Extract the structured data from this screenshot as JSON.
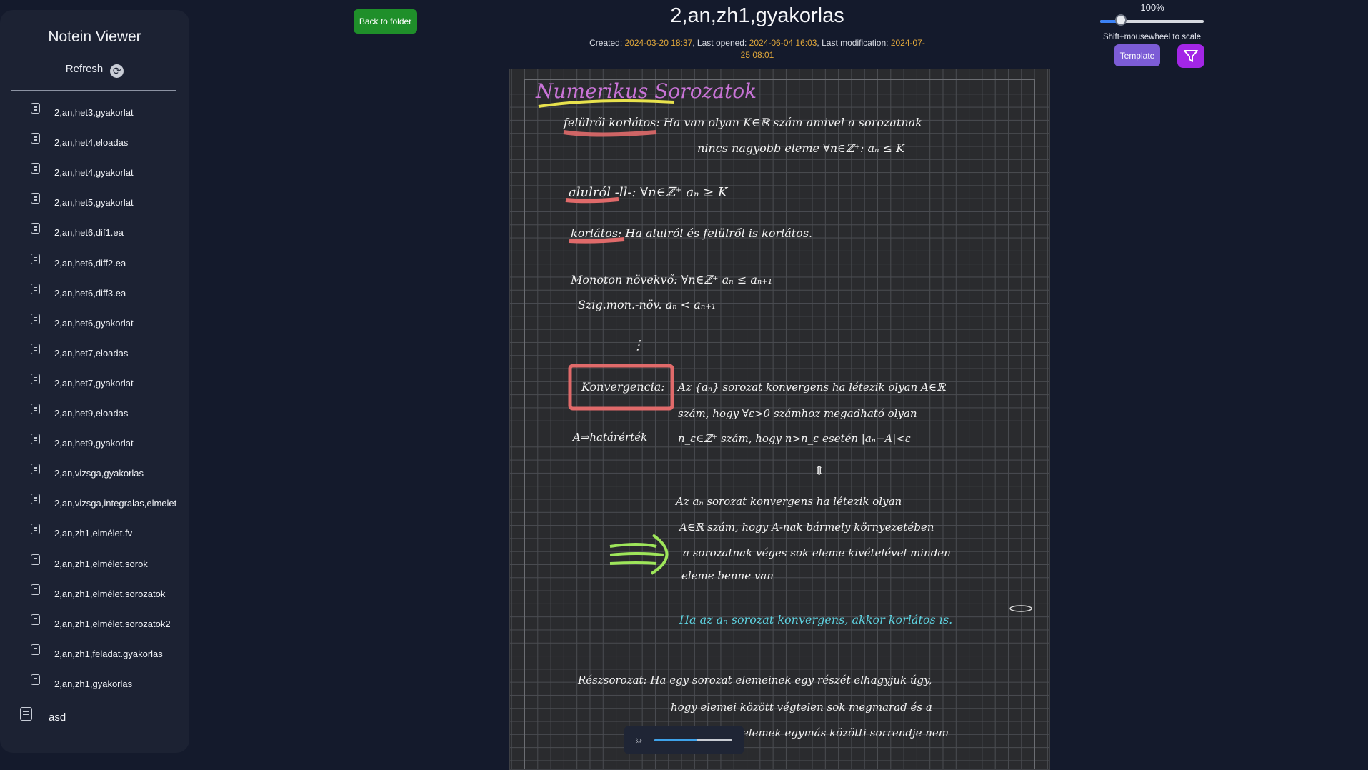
{
  "sidebar": {
    "app_title": "Notein Viewer",
    "refresh_label": "Refresh",
    "files": [
      "2,an,het3,gyakorlat",
      "2,an,het4,eloadas",
      "2,an,het4,gyakorlat",
      "2,an,het5,gyakorlat",
      "2,an,het6,dif1.ea",
      "2,an,het6,diff2.ea",
      "2,an,het6,diff3.ea",
      "2,an,het6,gyakorlat",
      "2,an,het7,eloadas",
      "2,an,het7,gyakorlat",
      "2,an,het9,eloadas",
      "2,an,het9,gyakorlat",
      "2,an,vizsga,gyakorlas",
      "2,an,vizsga,integralas,elmelet",
      "2,an,zh1,elmélet.fv",
      "2,an,zh1,elmélet.sorok",
      "2,an,zh1,elmélet.sorozatok",
      "2,an,zh1,elmélet.sorozatok2",
      "2,an,zh1,feladat.gyakorlas",
      "2,an,zh1,gyakorlas"
    ],
    "extra_file": "asd"
  },
  "header": {
    "back_label": "Back to folder",
    "title": "2,an,zh1,gyakorlas",
    "created_label": "Created:",
    "created": "2024-03-20 18:37",
    "opened_label": "Last opened:",
    "opened": "2024-06-04 16:03",
    "modified_label": "Last modification:",
    "modified": "2024-07-25 08:01"
  },
  "controls": {
    "scale_percent": "100%",
    "scale_level": 0.2,
    "scale_hint": "Shift+mousewheel to scale",
    "template_label": "Template"
  },
  "brightness": {
    "level": 0.55
  },
  "note": {
    "heading": "Numerikus Sorozatok",
    "lines": [
      "felülről korlátos: Ha van olyan K∈ℝ szám amivel a sorozatnak",
      "nincs nagyobb eleme ∀n∈ℤ⁺: aₙ ≤ K",
      "alulról -ll-: ∀n∈ℤ⁺ aₙ ≥ K",
      "korlátos: Ha alulról és felülről is korlátos.",
      "Monoton növekvő: ∀n∈ℤ⁺  aₙ ≤ aₙ₊₁",
      "Szig.mon.-növ.           aₙ < aₙ₊₁",
      "⋮",
      "Konvergencia:",
      "Az {aₙ} sorozat konvergens ha létezik olyan A∈ℝ",
      "szám, hogy ∀ε>0 számhoz megadható olyan",
      "A⇒határérték",
      "n_ε∈ℤ⁺ szám, hogy n>n_ε esetén |aₙ−A|<ε",
      "⇕",
      "Az aₙ sorozat konvergens ha létezik olyan",
      "A∈ℝ szám, hogy A-nak bármely környezetében",
      "a sorozatnak véges sok eleme kivételével minden",
      "eleme benne van",
      "Ha az aₙ sorozat konvergens, akkor korlátos is.",
      "Részsorozat: Ha egy sorozat elemeinek egy részét elhagyjuk úgy,",
      "hogy elemei között végtelen sok megmarad és a",
      "elemek egymás közötti sorrendje nem"
    ]
  }
}
